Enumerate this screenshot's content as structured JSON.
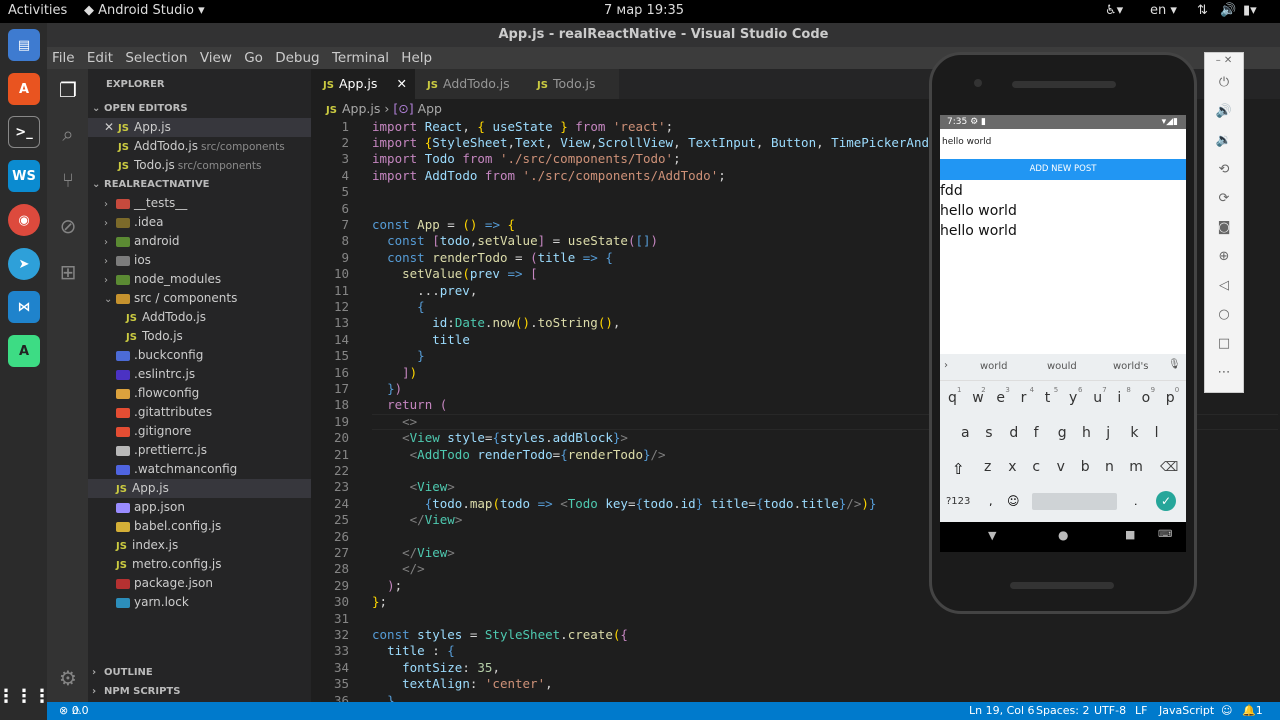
{
  "topbar": {
    "activities": "Activities",
    "app": "Android Studio",
    "datetime": "7 мар  19:35",
    "lang": "en"
  },
  "window_title": "App.js - realReactNative - Visual Studio Code",
  "menu": [
    "File",
    "Edit",
    "Selection",
    "View",
    "Go",
    "Debug",
    "Terminal",
    "Help"
  ],
  "sidebar": {
    "explorer": "EXPLORER",
    "open_editors": "OPEN EDITORS",
    "open": [
      {
        "name": "App.js",
        "desc": ""
      },
      {
        "name": "AddTodo.js",
        "desc": "src/components"
      },
      {
        "name": "Todo.js",
        "desc": "src/components"
      }
    ],
    "project": "REALREACTNATIVE",
    "tree": [
      "__tests__",
      ".idea",
      "android",
      "ios",
      "node_modules",
      "src / components",
      "AddTodo.js",
      "Todo.js",
      ".buckconfig",
      ".eslintrc.js",
      ".flowconfig",
      ".gitattributes",
      ".gitignore",
      ".prettierrc.js",
      ".watchmanconfig",
      "App.js",
      "app.json",
      "babel.config.js",
      "index.js",
      "metro.config.js",
      "package.json",
      "yarn.lock"
    ],
    "outline": "OUTLINE",
    "npm": "NPM SCRIPTS"
  },
  "tabs": [
    "App.js",
    "AddTodo.js",
    "Todo.js"
  ],
  "breadcrumb": {
    "file": "App.js",
    "symbol": "App"
  },
  "status": {
    "errors": "0",
    "warnings": "0",
    "pos": "Ln 19, Col 6",
    "spaces": "Spaces: 2",
    "enc": "UTF-8",
    "eol": "LF",
    "lang": "JavaScript",
    "notif": "1"
  },
  "phone": {
    "time": "7:35",
    "input": "hello world",
    "button": "ADD NEW POST",
    "items": [
      "fdd",
      "hello world",
      "hello world"
    ],
    "suggestions": [
      "world",
      "would",
      "world's"
    ],
    "row1": [
      "q",
      "w",
      "e",
      "r",
      "t",
      "y",
      "u",
      "i",
      "o",
      "p"
    ],
    "row1_nums": [
      "1",
      "2",
      "3",
      "4",
      "5",
      "6",
      "7",
      "8",
      "9",
      "0"
    ],
    "row2": [
      "a",
      "s",
      "d",
      "f",
      "g",
      "h",
      "j",
      "k",
      "l"
    ],
    "row3": [
      "z",
      "x",
      "c",
      "v",
      "b",
      "n",
      "m"
    ],
    "sym": "?123",
    "comma": ",",
    "period": "."
  }
}
